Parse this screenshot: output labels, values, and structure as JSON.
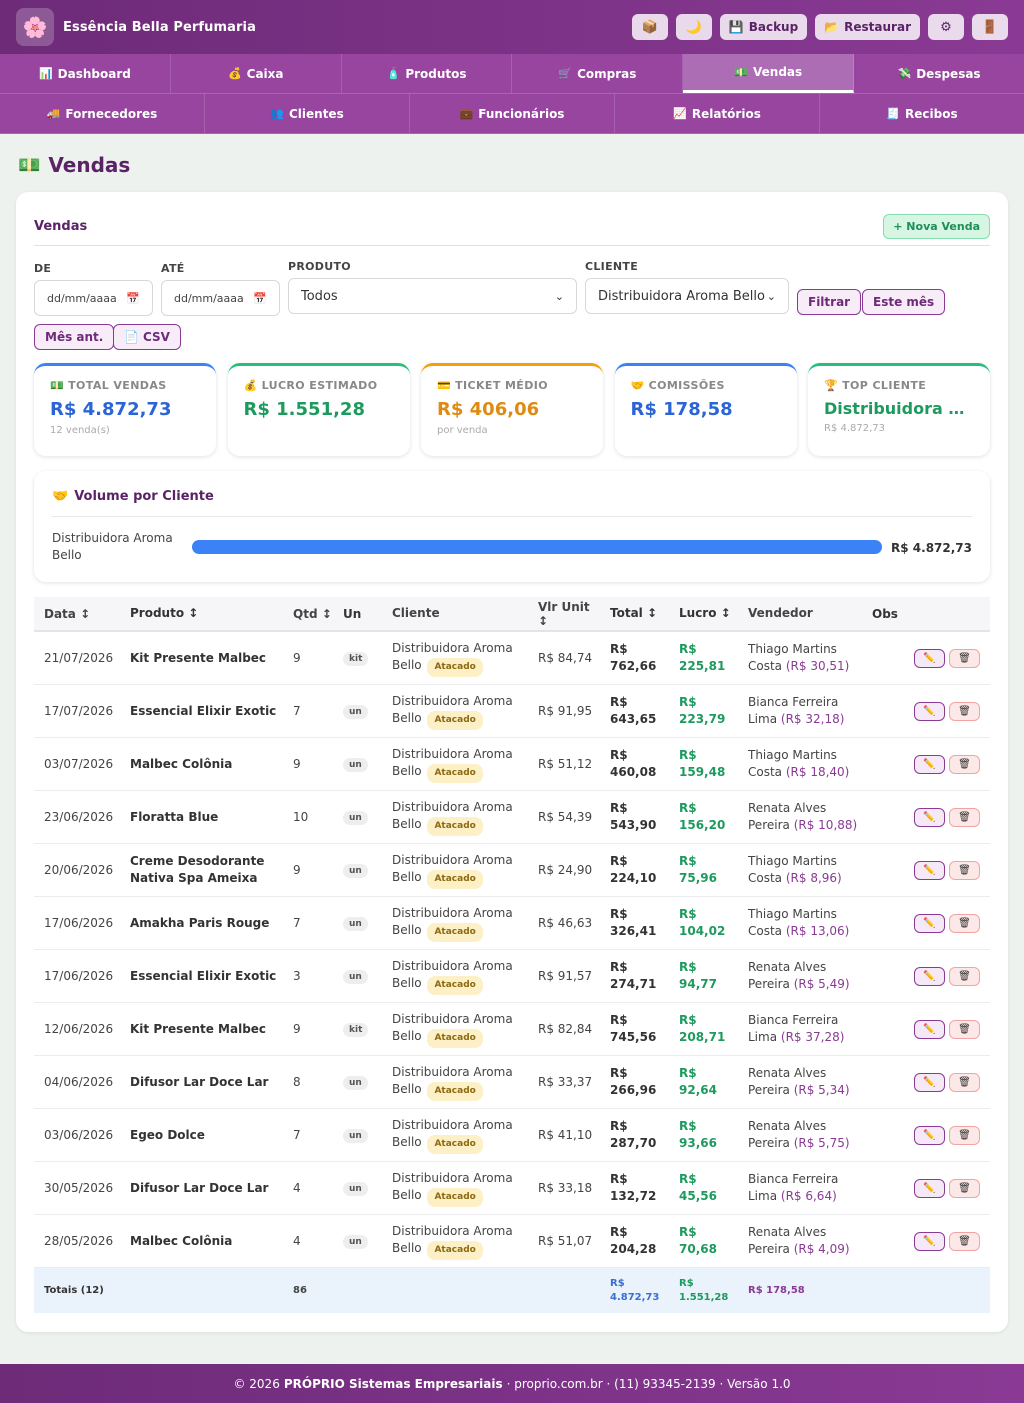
{
  "app": {
    "title": "Essência Bella Perfumaria",
    "logo_icon": "🌸"
  },
  "top_actions": [
    {
      "name": "notes-button",
      "icon": "📦",
      "label": ""
    },
    {
      "name": "theme-toggle-button",
      "icon": "🌙",
      "label": ""
    },
    {
      "name": "backup-button",
      "icon": "💾",
      "label": "Backup"
    },
    {
      "name": "restore-button",
      "icon": "📂",
      "label": "Restaurar"
    },
    {
      "name": "settings-button",
      "icon": "⚙",
      "label": ""
    },
    {
      "name": "logout-button",
      "icon": "🚪",
      "label": ""
    }
  ],
  "nav": {
    "row1": [
      {
        "icon": "📊",
        "label": "Dashboard",
        "active": false
      },
      {
        "icon": "💰",
        "label": "Caixa",
        "active": false
      },
      {
        "icon": "🧴",
        "label": "Produtos",
        "active": false
      },
      {
        "icon": "🛒",
        "label": "Compras",
        "active": false
      },
      {
        "icon": "💵",
        "label": "Vendas",
        "active": true
      },
      {
        "icon": "💸",
        "label": "Despesas",
        "active": false
      }
    ],
    "row2": [
      {
        "icon": "🚚",
        "label": "Fornecedores"
      },
      {
        "icon": "👥",
        "label": "Clientes"
      },
      {
        "icon": "💼",
        "label": "Funcionários"
      },
      {
        "icon": "📈",
        "label": "Relatórios"
      },
      {
        "icon": "🧾",
        "label": "Recibos"
      }
    ]
  },
  "page": {
    "icon": "💵",
    "title": "Vendas"
  },
  "card": {
    "title": "Vendas",
    "new_sale_label": "+ Nova Venda"
  },
  "filters": {
    "de_label": "DE",
    "ate_label": "ATÉ",
    "produto_label": "PRODUTO",
    "cliente_label": "CLIENTE",
    "de_placeholder": "dd/mm/aaaa",
    "ate_placeholder": "dd/mm/aaaa",
    "produto_value": "Todos",
    "cliente_value": "Distribuidora Aroma Bello",
    "filtrar_label": "Filtrar",
    "este_mes_label": "Este mês",
    "mes_ant_label": "Mês ant.",
    "csv_label": "CSV"
  },
  "stats": [
    {
      "icon": "💵",
      "label": "TOTAL VENDAS",
      "value": "R$ 4.872,73",
      "sub": "12 venda(s)",
      "color": "#2a64d6",
      "border": "#3b82f6"
    },
    {
      "icon": "💰",
      "label": "LUCRO ESTIMADO",
      "value": "R$ 1.551,28",
      "sub": "",
      "color": "#1e9a5e",
      "border": "#22c07a"
    },
    {
      "icon": "💳",
      "label": "TICKET MÉDIO",
      "value": "R$ 406,06",
      "sub": "por venda",
      "color": "#df8a12",
      "border": "#f59e0b"
    },
    {
      "icon": "🤝",
      "label": "COMISSÕES",
      "value": "R$ 178,58",
      "sub": "",
      "color": "#2a64d6",
      "border": "#3b82f6"
    },
    {
      "icon": "🏆",
      "label": "TOP CLIENTE",
      "value": "Distribuidora Aroma Bello",
      "sub": "R$ 4.872,73",
      "color": "#1e9a5e",
      "border": "#22c07a"
    }
  ],
  "volume": {
    "icon": "🤝",
    "title": "Volume por Cliente",
    "client": "Distribuidora Aroma Bello",
    "value": "R$ 4.872,73",
    "share": 1.0,
    "bar_color": "#3b82f6"
  },
  "table": {
    "headers": {
      "data": "Data ↕",
      "produto": "Produto ↕",
      "qtd": "Qtd ↕",
      "un": "Un",
      "cliente": "Cliente",
      "vlr": "Vlr Unit ↕",
      "total": "Total ↕",
      "lucro": "Lucro ↕",
      "vendedor": "Vendedor",
      "obs": "Obs"
    },
    "rows": [
      {
        "data": "21/07/2026",
        "produto": "Kit Presente Malbec",
        "qtd": "9",
        "un": "kit",
        "cliente": "Distribuidora Aroma Bello",
        "tag": "Atacado",
        "vlr": "R$ 84,74",
        "total": "R$ 762,66",
        "lucro": "R$ 225,81",
        "vendedor": "Thiago Martins Costa",
        "comissao": "(R$ 30,51)"
      },
      {
        "data": "17/07/2026",
        "produto": "Essencial Elixir Exotic",
        "qtd": "7",
        "un": "un",
        "cliente": "Distribuidora Aroma Bello",
        "tag": "Atacado",
        "vlr": "R$ 91,95",
        "total": "R$ 643,65",
        "lucro": "R$ 223,79",
        "vendedor": "Bianca Ferreira Lima",
        "comissao": "(R$ 32,18)"
      },
      {
        "data": "03/07/2026",
        "produto": "Malbec Colônia",
        "qtd": "9",
        "un": "un",
        "cliente": "Distribuidora Aroma Bello",
        "tag": "Atacado",
        "vlr": "R$ 51,12",
        "total": "R$ 460,08",
        "lucro": "R$ 159,48",
        "vendedor": "Thiago Martins Costa",
        "comissao": "(R$ 18,40)"
      },
      {
        "data": "23/06/2026",
        "produto": "Floratta Blue",
        "qtd": "10",
        "un": "un",
        "cliente": "Distribuidora Aroma Bello",
        "tag": "Atacado",
        "vlr": "R$ 54,39",
        "total": "R$ 543,90",
        "lucro": "R$ 156,20",
        "vendedor": "Renata Alves Pereira",
        "comissao": "(R$ 10,88)"
      },
      {
        "data": "20/06/2026",
        "produto": "Creme Desodorante Nativa Spa Ameixa",
        "qtd": "9",
        "un": "un",
        "cliente": "Distribuidora Aroma Bello",
        "tag": "Atacado",
        "vlr": "R$ 24,90",
        "total": "R$ 224,10",
        "lucro": "R$ 75,96",
        "vendedor": "Thiago Martins Costa",
        "comissao": "(R$ 8,96)"
      },
      {
        "data": "17/06/2026",
        "produto": "Amakha Paris Rouge",
        "qtd": "7",
        "un": "un",
        "cliente": "Distribuidora Aroma Bello",
        "tag": "Atacado",
        "vlr": "R$ 46,63",
        "total": "R$ 326,41",
        "lucro": "R$ 104,02",
        "vendedor": "Thiago Martins Costa",
        "comissao": "(R$ 13,06)"
      },
      {
        "data": "17/06/2026",
        "produto": "Essencial Elixir Exotic",
        "qtd": "3",
        "un": "un",
        "cliente": "Distribuidora Aroma Bello",
        "tag": "Atacado",
        "vlr": "R$ 91,57",
        "total": "R$ 274,71",
        "lucro": "R$ 94,77",
        "vendedor": "Renata Alves Pereira",
        "comissao": "(R$ 5,49)"
      },
      {
        "data": "12/06/2026",
        "produto": "Kit Presente Malbec",
        "qtd": "9",
        "un": "kit",
        "cliente": "Distribuidora Aroma Bello",
        "tag": "Atacado",
        "vlr": "R$ 82,84",
        "total": "R$ 745,56",
        "lucro": "R$ 208,71",
        "vendedor": "Bianca Ferreira Lima",
        "comissao": "(R$ 37,28)"
      },
      {
        "data": "04/06/2026",
        "produto": "Difusor Lar Doce Lar",
        "qtd": "8",
        "un": "un",
        "cliente": "Distribuidora Aroma Bello",
        "tag": "Atacado",
        "vlr": "R$ 33,37",
        "total": "R$ 266,96",
        "lucro": "R$ 92,64",
        "vendedor": "Renata Alves Pereira",
        "comissao": "(R$ 5,34)"
      },
      {
        "data": "03/06/2026",
        "produto": "Egeo Dolce",
        "qtd": "7",
        "un": "un",
        "cliente": "Distribuidora Aroma Bello",
        "tag": "Atacado",
        "vlr": "R$ 41,10",
        "total": "R$ 287,70",
        "lucro": "R$ 93,66",
        "vendedor": "Renata Alves Pereira",
        "comissao": "(R$ 5,75)"
      },
      {
        "data": "30/05/2026",
        "produto": "Difusor Lar Doce Lar",
        "qtd": "4",
        "un": "un",
        "cliente": "Distribuidora Aroma Bello",
        "tag": "Atacado",
        "vlr": "R$ 33,18",
        "total": "R$ 132,72",
        "lucro": "R$ 45,56",
        "vendedor": "Bianca Ferreira Lima",
        "comissao": "(R$ 6,64)"
      },
      {
        "data": "28/05/2026",
        "produto": "Malbec Colônia",
        "qtd": "4",
        "un": "un",
        "cliente": "Distribuidora Aroma Bello",
        "tag": "Atacado",
        "vlr": "R$ 51,07",
        "total": "R$ 204,28",
        "lucro": "R$ 70,68",
        "vendedor": "Renata Alves Pereira",
        "comissao": "(R$ 4,09)"
      }
    ],
    "totals": {
      "label": "Totais (12)",
      "qtd": "86",
      "total": "R$ 4.872,73",
      "lucro": "R$ 1.551,28",
      "comissao": "R$ 178,58"
    }
  },
  "footer": {
    "prefix": "© 2026",
    "company": "PRÓPRIO Sistemas Empresariais",
    "rest": "· proprio.com.br · (11) 93345-2139 · Versão 1.0"
  },
  "icons": {
    "edit": "✏️",
    "delete": "🗑",
    "calendar": "📅",
    "chevron": "⌄",
    "csv": "📄"
  }
}
